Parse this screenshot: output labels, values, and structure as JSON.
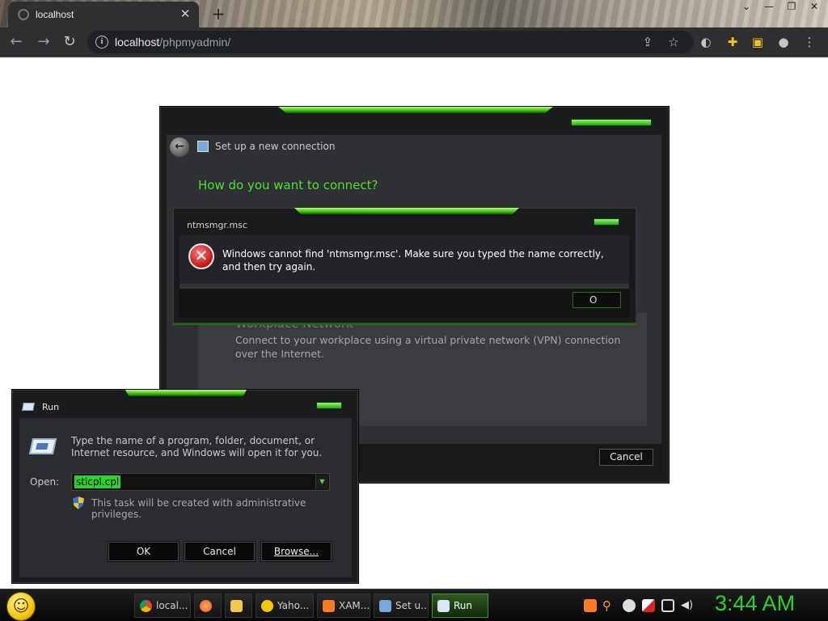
{
  "browser": {
    "tab_title": "localhost",
    "new_tab": "+",
    "url_host": "localhost",
    "url_path": "/phpmyadmin/",
    "window_controls": [
      "⌄",
      "—",
      "❐",
      "✕"
    ]
  },
  "setup": {
    "title": "Set up a new connection",
    "heading": "How do you want to connect?",
    "option_title": "Workplace Network",
    "option_desc": "Connect to your workplace using a virtual private network (VPN) connection over the Internet.",
    "cancel_label": "Cancel"
  },
  "error_dialog": {
    "caption": "ntmsmgr.msc",
    "message": "Windows cannot find 'ntmsmgr.msc'. Make sure you typed the name correctly, and then try again.",
    "ok_label": "O"
  },
  "run_dialog": {
    "title": "Run",
    "description": "Type the name of a program, folder, document, or Internet resource, and Windows will open it for you.",
    "open_label": "Open:",
    "input_value": "sticpl.cpl",
    "admin_note": "This task will be created with administrative privileges.",
    "ok_label": "OK",
    "cancel_label": "Cancel",
    "browse_label": "Browse..."
  },
  "taskbar": {
    "tasks": [
      {
        "label": "local...",
        "icon_color": "#db4437"
      },
      {
        "label": "",
        "icon_color": "#ff7139"
      },
      {
        "label": "",
        "icon_color": "#f2c94c"
      },
      {
        "label": "Yaho...",
        "icon_color": "#f3c70b"
      },
      {
        "label": "XAM...",
        "icon_color": "#fb7a24"
      },
      {
        "label": "Set u...",
        "icon_color": "#7aa7d9"
      },
      {
        "label": "Run",
        "icon_color": "#d8e6f8"
      }
    ],
    "clock": "3:44 AM"
  },
  "colors": {
    "accent_green": "#4fe02e",
    "clock_green": "#2bd42b"
  }
}
